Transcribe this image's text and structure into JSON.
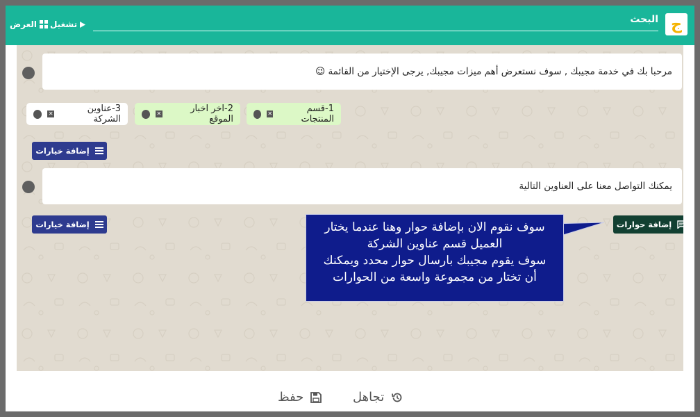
{
  "header": {
    "search_label": "البحث",
    "run_label": "تشغيل",
    "view_label": "العرض"
  },
  "messages": [
    {
      "text": "مرحبا بك في خدمة مجيبك , سوف نستعرض أهم ميزات مجيبك, يرجى الإختيار من القائمة 😉"
    },
    {
      "text": "يمكنك التواصل معنا على العناوين التالية"
    }
  ],
  "options": [
    {
      "label": "1-قسم المنتجات"
    },
    {
      "label": "2-اخر اخبار الموقع"
    },
    {
      "label": "3-عناوين الشركة"
    }
  ],
  "buttons": {
    "add_options": "إضافة خيارات",
    "add_options_2": "إضافة خيارات",
    "add_dialogs": "إضافة حوارات"
  },
  "tooltip": {
    "lines": [
      "سوف نقوم الان بإضافة حوار وهنا عندما يختار",
      "العميل قسم عناوين الشركة",
      "سوف يقوم مجيبك بارسال حوار محدد ويمكنك",
      "أن تختار من مجموعة واسعة من الحوارات"
    ]
  },
  "footer": {
    "ignore_label": "تجاهل",
    "save_label": "حفظ"
  },
  "colors": {
    "header": "#19b69a",
    "chat_bg": "#e1dbd0",
    "option_green": "#dcf8c6",
    "button_blue": "#2e3b8f",
    "button_dark": "#124032",
    "tooltip_bg": "#0f1c8c"
  }
}
